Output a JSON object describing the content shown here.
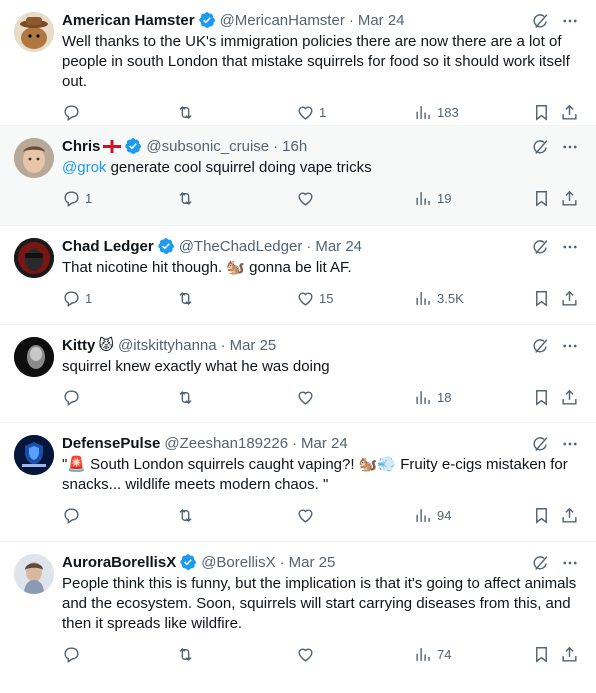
{
  "tweets": [
    {
      "name": "American Hamster",
      "handle": "@MericanHamster",
      "time": "Mar 24",
      "text": "Well thanks to the UK's immigration policies there are now there are a lot of people in south London that mistake squirrels for food so it should work itself out.",
      "replies": "",
      "retweets": "",
      "likes": "1",
      "views": "183"
    },
    {
      "name": "Chris",
      "handle": "@subsonic_cruise",
      "time": "16h",
      "mention": "@grok",
      "text": " generate cool squirrel doing vape tricks",
      "replies": "1",
      "retweets": "",
      "likes": "",
      "views": "19"
    },
    {
      "name": "Chad Ledger",
      "handle": "@TheChadLedger",
      "time": "Mar 24",
      "text": "That nicotine hit though. 🐿️ gonna be lit AF.",
      "replies": "1",
      "retweets": "",
      "likes": "15",
      "views": "3.5K"
    },
    {
      "name": "Kitty",
      "emoji": "😾",
      "handle": "@itskittyhanna",
      "time": "Mar 25",
      "text": "squirrel knew exactly what he was doing",
      "replies": "",
      "retweets": "",
      "likes": "",
      "views": "18"
    },
    {
      "name": "DefensePulse",
      "handle": "@Zeeshan189226",
      "time": "Mar 24",
      "text": "\"🚨 South London squirrels caught vaping?! 🐿️💨 Fruity e-cigs mistaken for snacks... wildlife meets modern chaos. \"",
      "replies": "",
      "retweets": "",
      "likes": "",
      "views": "94"
    },
    {
      "name": "AuroraBorellisX",
      "handle": "@BorellisX",
      "time": "Mar 25",
      "text": "People think this is funny, but the implication is that it's going to affect animals and the ecosystem. Soon, squirrels will start carrying diseases from this, and then it spreads like wildfire.",
      "replies": "",
      "retweets": "",
      "likes": "",
      "views": "74"
    }
  ],
  "colors": {
    "accent": "#1d9bf0",
    "muted": "#536471",
    "verified": "#1d9bf0",
    "highlight_bg": "#f7f9f9"
  },
  "icons": [
    "verified-icon",
    "grok-icon",
    "more-icon",
    "reply-icon",
    "retweet-icon",
    "like-icon",
    "views-icon",
    "bookmark-icon",
    "share-icon",
    "england-flag-icon"
  ]
}
